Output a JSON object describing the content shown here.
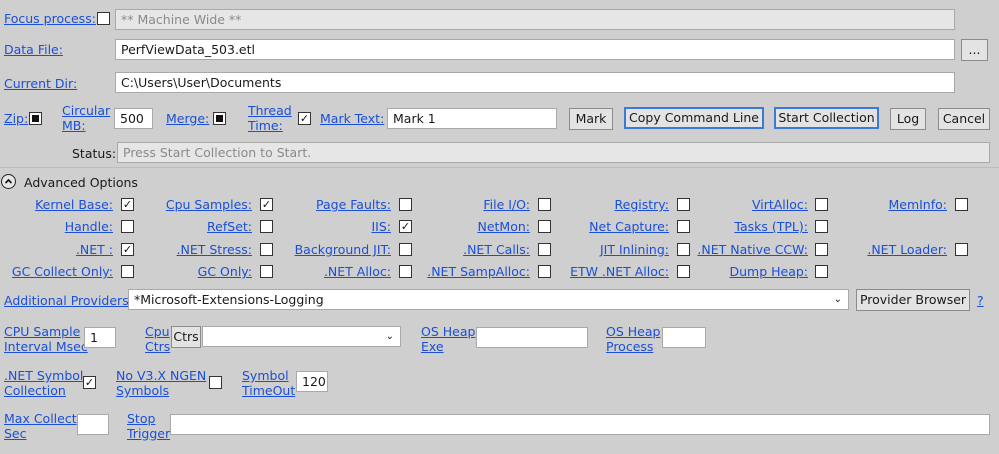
{
  "row_focus": {
    "label": "Focus process:",
    "value": "** Machine Wide **"
  },
  "row_datafile": {
    "label": "Data File:",
    "value": "PerfViewData_503.etl",
    "browse": "..."
  },
  "row_curdir": {
    "label": "Current Dir:",
    "value": "C:\\Users\\User\\Documents"
  },
  "row_options": {
    "zip": "Zip:",
    "circular": [
      "Circular",
      "MB:"
    ],
    "circular_value": "500",
    "merge": "Merge:",
    "thread_time": [
      "Thread",
      "Time:"
    ],
    "mark_text": "Mark Text:",
    "mark_value": "Mark 1",
    "buttons": {
      "mark": "Mark",
      "copy": "Copy Command Line",
      "start": "Start Collection",
      "log": "Log",
      "cancel": "Cancel"
    }
  },
  "status": {
    "label": "Status:",
    "value": "Press Start Collection to Start."
  },
  "advanced": {
    "title": "Advanced Options",
    "toggle_icon": "chevron-up-icon",
    "providers": [
      [
        "Kernel Base:",
        "Cpu Samples:",
        "Page Faults:",
        "File I/O:",
        "Registry:",
        "VirtAlloc:",
        "MemInfo:"
      ],
      [
        "Handle:",
        "RefSet:",
        "IIS:",
        "NetMon:",
        "Net Capture:",
        "Tasks (TPL):",
        ""
      ],
      [
        ".NET :",
        ".NET Stress:",
        "Background JIT:",
        ".NET Calls:",
        "JIT Inlining:",
        ".NET Native CCW:",
        ".NET Loader:"
      ],
      [
        "GC Collect Only:",
        "GC Only:",
        ".NET Alloc:",
        ".NET SampAlloc:",
        "ETW .NET Alloc:",
        "Dump Heap:",
        ""
      ]
    ],
    "checked": [
      [
        true,
        true,
        false,
        false,
        false,
        false,
        false
      ],
      [
        false,
        false,
        true,
        false,
        false,
        false,
        null
      ],
      [
        true,
        false,
        false,
        false,
        false,
        false,
        false
      ],
      [
        false,
        false,
        false,
        false,
        false,
        false,
        null
      ]
    ]
  },
  "additional": {
    "label": "Additional Providers:",
    "value": "*Microsoft-Extensions-Logging",
    "dropdown_icon": "chevron-down-icon",
    "browser_button": "Provider Browser",
    "help": "?"
  },
  "cpu_row": {
    "sample_label": [
      "CPU Sample",
      "Interval Msec"
    ],
    "sample_value": "1",
    "ctrs_label": [
      "Cpu",
      "Ctrs"
    ],
    "ctrs_button": "Ctrs",
    "heap_exe_label": [
      "OS Heap",
      "Exe"
    ],
    "heap_process_label": [
      "OS Heap",
      "Process"
    ]
  },
  "symbol_row": {
    "net_symbol": [
      ".NET Symbol",
      "Collection"
    ],
    "no_v3": [
      "No V3.X NGEN",
      "Symbols"
    ],
    "timeout_label": [
      "Symbol",
      "TimeOut"
    ],
    "timeout_value": "120"
  },
  "bottom_row": {
    "max_collect": [
      "Max Collect",
      "Sec"
    ],
    "stop_trigger": [
      "Stop",
      "Trigger"
    ]
  }
}
